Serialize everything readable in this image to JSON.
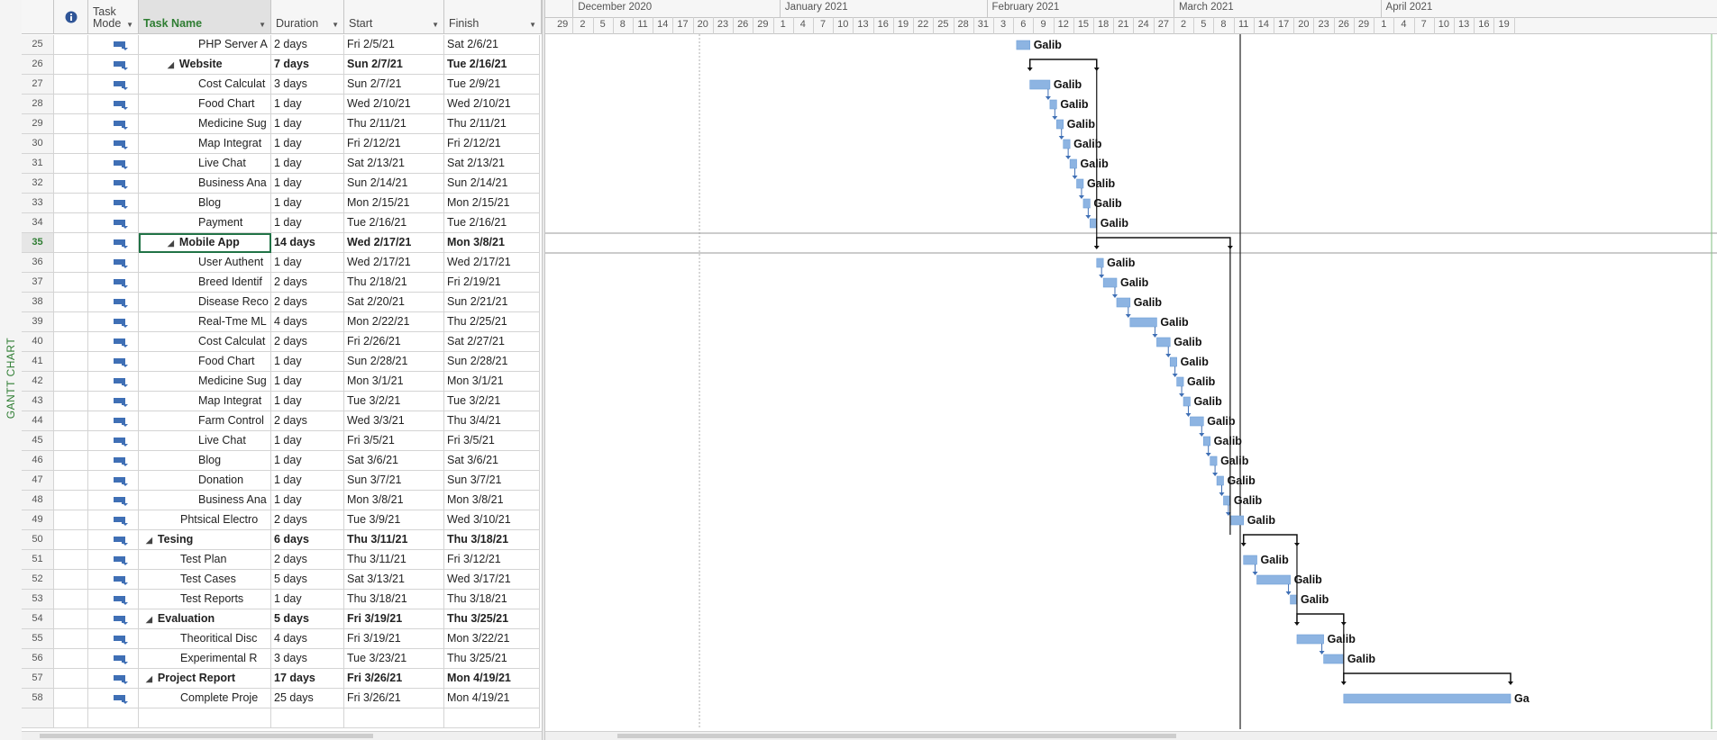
{
  "side_view_label": "GANTT CHART",
  "columns": {
    "indicators_icon": "info-icon",
    "mode": "Task\nMode",
    "name": "Task Name",
    "duration": "Duration",
    "start": "Start",
    "finish": "Finish"
  },
  "timescale": {
    "months": [
      "December 2020",
      "January 2021",
      "February 2021",
      "March 2021",
      "April 2021"
    ],
    "days": [
      "29",
      "2",
      "5",
      "8",
      "11",
      "14",
      "17",
      "20",
      "23",
      "26",
      "29",
      "1",
      "4",
      "7",
      "10",
      "13",
      "16",
      "19",
      "22",
      "25",
      "28",
      "31",
      "3",
      "6",
      "9",
      "12",
      "15",
      "18",
      "21",
      "24",
      "27",
      "2",
      "5",
      "8",
      "11",
      "14",
      "17",
      "20",
      "23",
      "26",
      "29",
      "1",
      "4",
      "7",
      "10",
      "13",
      "16",
      "19"
    ]
  },
  "tasks": [
    {
      "id": "25",
      "name": "PHP Server A",
      "duration": "2 days",
      "start": "Fri 2/5/21",
      "finish": "Sat 2/6/21",
      "level": 3,
      "summary": false
    },
    {
      "id": "26",
      "name": "Website",
      "duration": "7 days",
      "start": "Sun 2/7/21",
      "finish": "Tue 2/16/21",
      "level": 2,
      "summary": true
    },
    {
      "id": "27",
      "name": "Cost Calculat",
      "duration": "3 days",
      "start": "Sun 2/7/21",
      "finish": "Tue 2/9/21",
      "level": 3,
      "summary": false
    },
    {
      "id": "28",
      "name": "Food Chart",
      "duration": "1 day",
      "start": "Wed 2/10/21",
      "finish": "Wed 2/10/21",
      "level": 3,
      "summary": false
    },
    {
      "id": "29",
      "name": "Medicine Sug",
      "duration": "1 day",
      "start": "Thu 2/11/21",
      "finish": "Thu 2/11/21",
      "level": 3,
      "summary": false
    },
    {
      "id": "30",
      "name": "Map Integrat",
      "duration": "1 day",
      "start": "Fri 2/12/21",
      "finish": "Fri 2/12/21",
      "level": 3,
      "summary": false
    },
    {
      "id": "31",
      "name": "Live Chat",
      "duration": "1 day",
      "start": "Sat 2/13/21",
      "finish": "Sat 2/13/21",
      "level": 3,
      "summary": false
    },
    {
      "id": "32",
      "name": "Business Ana",
      "duration": "1 day",
      "start": "Sun 2/14/21",
      "finish": "Sun 2/14/21",
      "level": 3,
      "summary": false
    },
    {
      "id": "33",
      "name": "Blog",
      "duration": "1 day",
      "start": "Mon 2/15/21",
      "finish": "Mon 2/15/21",
      "level": 3,
      "summary": false
    },
    {
      "id": "34",
      "name": "Payment",
      "duration": "1 day",
      "start": "Tue 2/16/21",
      "finish": "Tue 2/16/21",
      "level": 3,
      "summary": false
    },
    {
      "id": "35",
      "name": "Mobile App",
      "duration": "14 days",
      "start": "Wed 2/17/21",
      "finish": "Mon 3/8/21",
      "level": 2,
      "summary": true,
      "current": true
    },
    {
      "id": "36",
      "name": "User Authent",
      "duration": "1 day",
      "start": "Wed 2/17/21",
      "finish": "Wed 2/17/21",
      "level": 3,
      "summary": false
    },
    {
      "id": "37",
      "name": "Breed Identif",
      "duration": "2 days",
      "start": "Thu 2/18/21",
      "finish": "Fri 2/19/21",
      "level": 3,
      "summary": false
    },
    {
      "id": "38",
      "name": "Disease Reco",
      "duration": "2 days",
      "start": "Sat 2/20/21",
      "finish": "Sun 2/21/21",
      "level": 3,
      "summary": false
    },
    {
      "id": "39",
      "name": "Real-Tme ML",
      "duration": "4 days",
      "start": "Mon 2/22/21",
      "finish": "Thu 2/25/21",
      "level": 3,
      "summary": false
    },
    {
      "id": "40",
      "name": "Cost Calculat",
      "duration": "2 days",
      "start": "Fri 2/26/21",
      "finish": "Sat 2/27/21",
      "level": 3,
      "summary": false
    },
    {
      "id": "41",
      "name": "Food Chart",
      "duration": "1 day",
      "start": "Sun 2/28/21",
      "finish": "Sun 2/28/21",
      "level": 3,
      "summary": false
    },
    {
      "id": "42",
      "name": "Medicine Sug",
      "duration": "1 day",
      "start": "Mon 3/1/21",
      "finish": "Mon 3/1/21",
      "level": 3,
      "summary": false
    },
    {
      "id": "43",
      "name": "Map Integrat",
      "duration": "1 day",
      "start": "Tue 3/2/21",
      "finish": "Tue 3/2/21",
      "level": 3,
      "summary": false
    },
    {
      "id": "44",
      "name": "Farm Control",
      "duration": "2 days",
      "start": "Wed 3/3/21",
      "finish": "Thu 3/4/21",
      "level": 3,
      "summary": false
    },
    {
      "id": "45",
      "name": "Live Chat",
      "duration": "1 day",
      "start": "Fri 3/5/21",
      "finish": "Fri 3/5/21",
      "level": 3,
      "summary": false
    },
    {
      "id": "46",
      "name": "Blog",
      "duration": "1 day",
      "start": "Sat 3/6/21",
      "finish": "Sat 3/6/21",
      "level": 3,
      "summary": false
    },
    {
      "id": "47",
      "name": "Donation",
      "duration": "1 day",
      "start": "Sun 3/7/21",
      "finish": "Sun 3/7/21",
      "level": 3,
      "summary": false
    },
    {
      "id": "48",
      "name": "Business Ana",
      "duration": "1 day",
      "start": "Mon 3/8/21",
      "finish": "Mon 3/8/21",
      "level": 3,
      "summary": false
    },
    {
      "id": "49",
      "name": "Phtsical Electro",
      "duration": "2 days",
      "start": "Tue 3/9/21",
      "finish": "Wed 3/10/21",
      "level": 2,
      "summary": false
    },
    {
      "id": "50",
      "name": "Tesing",
      "duration": "6 days",
      "start": "Thu 3/11/21",
      "finish": "Thu 3/18/21",
      "level": 1,
      "summary": true
    },
    {
      "id": "51",
      "name": "Test Plan",
      "duration": "2 days",
      "start": "Thu 3/11/21",
      "finish": "Fri 3/12/21",
      "level": 2,
      "summary": false
    },
    {
      "id": "52",
      "name": "Test Cases",
      "duration": "5 days",
      "start": "Sat 3/13/21",
      "finish": "Wed 3/17/21",
      "level": 2,
      "summary": false
    },
    {
      "id": "53",
      "name": "Test Reports",
      "duration": "1 day",
      "start": "Thu 3/18/21",
      "finish": "Thu 3/18/21",
      "level": 2,
      "summary": false
    },
    {
      "id": "54",
      "name": "Evaluation",
      "duration": "5 days",
      "start": "Fri 3/19/21",
      "finish": "Thu 3/25/21",
      "level": 1,
      "summary": true
    },
    {
      "id": "55",
      "name": "Theoritical Disc",
      "duration": "4 days",
      "start": "Fri 3/19/21",
      "finish": "Mon 3/22/21",
      "level": 2,
      "summary": false
    },
    {
      "id": "56",
      "name": "Experimental R",
      "duration": "3 days",
      "start": "Tue 3/23/21",
      "finish": "Thu 3/25/21",
      "level": 2,
      "summary": false
    },
    {
      "id": "57",
      "name": "Project Report",
      "duration": "17 days",
      "start": "Fri 3/26/21",
      "finish": "Mon 4/19/21",
      "level": 1,
      "summary": true
    },
    {
      "id": "58",
      "name": "Complete Proje",
      "duration": "25 days",
      "start": "Fri 3/26/21",
      "finish": "Mon 4/19/21",
      "level": 2,
      "summary": false
    },
    {
      "id": "",
      "name": "",
      "duration": "",
      "start": "",
      "finish": "",
      "level": 0,
      "summary": false,
      "empty": true
    }
  ],
  "resource_label": "Galib",
  "last_resource_label": "Ga",
  "colors": {
    "bar": "#8db4e2",
    "accent": "#217346",
    "header_bg": "#f6f6f6"
  }
}
